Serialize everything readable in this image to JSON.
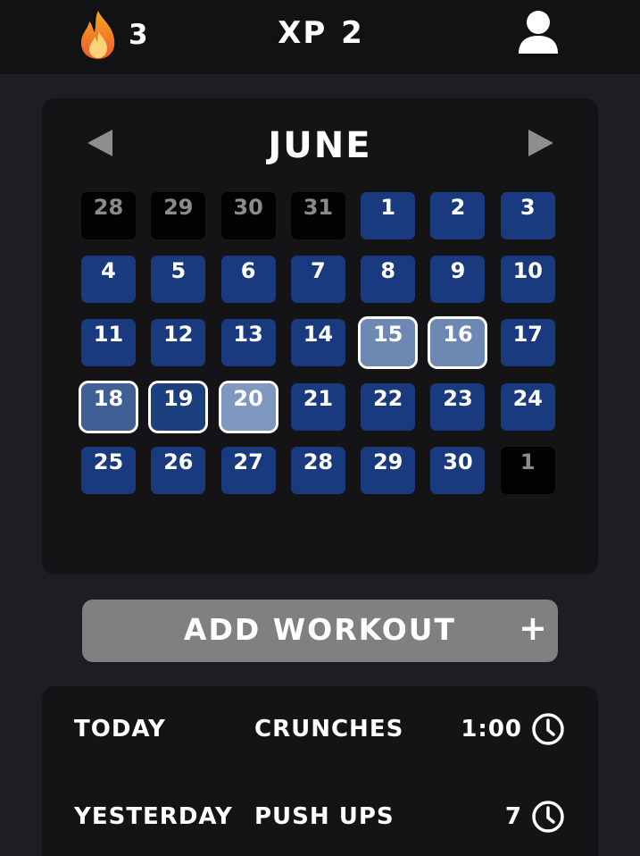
{
  "header": {
    "streak_count": "3",
    "xp_label": "XP",
    "xp_value": "2"
  },
  "calendar": {
    "month": "JUNE",
    "days": [
      {
        "n": "28",
        "state": "other"
      },
      {
        "n": "29",
        "state": "other"
      },
      {
        "n": "30",
        "state": "other"
      },
      {
        "n": "31",
        "state": "other"
      },
      {
        "n": "1",
        "state": "normal"
      },
      {
        "n": "2",
        "state": "normal"
      },
      {
        "n": "3",
        "state": "normal"
      },
      {
        "n": "4",
        "state": "normal"
      },
      {
        "n": "5",
        "state": "normal"
      },
      {
        "n": "6",
        "state": "normal"
      },
      {
        "n": "7",
        "state": "normal"
      },
      {
        "n": "8",
        "state": "normal"
      },
      {
        "n": "9",
        "state": "normal"
      },
      {
        "n": "10",
        "state": "normal"
      },
      {
        "n": "11",
        "state": "normal"
      },
      {
        "n": "12",
        "state": "normal"
      },
      {
        "n": "13",
        "state": "normal"
      },
      {
        "n": "14",
        "state": "normal"
      },
      {
        "n": "15",
        "state": "sel-light"
      },
      {
        "n": "16",
        "state": "sel-light"
      },
      {
        "n": "17",
        "state": "normal"
      },
      {
        "n": "18",
        "state": "sel-mid"
      },
      {
        "n": "19",
        "state": "sel-dark"
      },
      {
        "n": "20",
        "state": "sel-pale"
      },
      {
        "n": "21",
        "state": "normal"
      },
      {
        "n": "22",
        "state": "normal"
      },
      {
        "n": "23",
        "state": "normal"
      },
      {
        "n": "24",
        "state": "normal"
      },
      {
        "n": "25",
        "state": "normal"
      },
      {
        "n": "26",
        "state": "normal"
      },
      {
        "n": "27",
        "state": "normal"
      },
      {
        "n": "28",
        "state": "normal"
      },
      {
        "n": "29",
        "state": "normal"
      },
      {
        "n": "30",
        "state": "normal"
      },
      {
        "n": "1",
        "state": "other"
      }
    ]
  },
  "add_workout": {
    "label": "ADD WORKOUT",
    "plus": "+"
  },
  "log": [
    {
      "when": "TODAY",
      "what": "CRUNCHES",
      "duration": "1:00",
      "icon": "clock-icon"
    },
    {
      "when": "YESTERDAY",
      "what": "PUSH UPS",
      "duration": "7",
      "icon": "clock-icon"
    }
  ],
  "colors": {
    "day": "#1a3a80",
    "other_day": "#020203",
    "add_button": "#808080",
    "flame_outer": "#f2792f",
    "flame_inner": "#ffd27a"
  }
}
